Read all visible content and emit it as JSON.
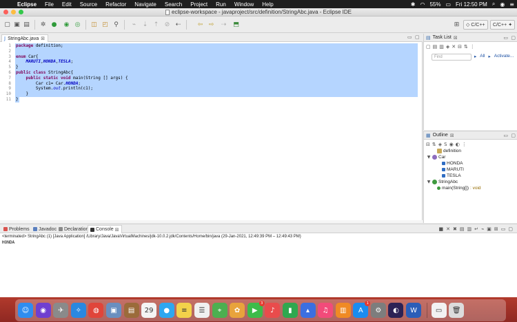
{
  "menubar": {
    "apple": "",
    "items": [
      "Eclipse",
      "File",
      "Edit",
      "Source",
      "Refactor",
      "Navigate",
      "Search",
      "Project",
      "Run",
      "Window",
      "Help"
    ],
    "battery": "55%",
    "clock": "Fri 12:50 PM"
  },
  "window": {
    "title": "eclipse-workspace - javaproject/src/definition/StringAbc.java - Eclipse IDE"
  },
  "toolbar": {
    "perspective_cpp": "C/C++",
    "perspective_cvs": "C/C++"
  },
  "editor": {
    "tab_label": "StringAbc.java",
    "close_glyph": "⊠",
    "lines": [
      {
        "n": "1",
        "html": "<span class=\"kw\">package</span> definition;"
      },
      {
        "n": "2",
        "html": ""
      },
      {
        "n": "3",
        "html": "<span class=\"kw\">enum</span> Car{"
      },
      {
        "n": "4",
        "html": "    <span class=\"en\">MARUTI</span>,<span class=\"en\">HONDA</span>,<span class=\"en\">TESLA</span>;"
      },
      {
        "n": "5",
        "html": "}"
      },
      {
        "n": "6",
        "html": "<span class=\"kw\">public class</span> StringAbc{"
      },
      {
        "n": "7",
        "html": "    <span class=\"kw\">public static void</span> main(String [] args) {"
      },
      {
        "n": "8",
        "html": "        Car c1= Car.<span class=\"en\">HONDA</span>;"
      },
      {
        "n": "9",
        "html": "        System.<span class=\"fld\">out</span>.println(c1);"
      },
      {
        "n": "10",
        "html": "    }"
      },
      {
        "n": "11",
        "html": "}"
      }
    ]
  },
  "tasklist": {
    "tab_label": "Task List",
    "find_placeholder": "Find",
    "all_label": "All",
    "activate_label": "Activate..."
  },
  "outline": {
    "tab_label": "Outline",
    "nodes": [
      {
        "label": "definition",
        "icon": "package-icon",
        "indent": 1,
        "twisty": ""
      },
      {
        "label": "Car",
        "icon": "enum-icon",
        "indent": 0,
        "twisty": "▼"
      },
      {
        "label": "HONDA",
        "icon": "constant-icon",
        "indent": 2,
        "twisty": ""
      },
      {
        "label": "MARUTI",
        "icon": "constant-icon",
        "indent": 2,
        "twisty": ""
      },
      {
        "label": "TESLA",
        "icon": "constant-icon",
        "indent": 2,
        "twisty": ""
      },
      {
        "label": "StringAbc",
        "icon": "class-icon",
        "indent": 0,
        "twisty": "▼"
      },
      {
        "label": "main(String[])",
        "sig": " : void",
        "icon": "method-icon",
        "indent": 1,
        "twisty": ""
      }
    ]
  },
  "console": {
    "tabs": [
      "Problems",
      "Javadoc",
      "Declaration",
      "Console"
    ],
    "active_tab": "Console",
    "status": "<terminated> StringAbc (1) [Java Application] /Library/Java/JavaVirtualMachines/jdk-10.0.2.jdk/Contents/Home/bin/java  (29-Jan-2021, 12:49:39 PM – 12:49:43 PM)",
    "output": "HONDA"
  },
  "dock": {
    "apps": [
      {
        "name": "finder-icon",
        "bg": "#2f8df0",
        "glyph": "☺"
      },
      {
        "name": "siri-icon",
        "bg": "#6f3fd0",
        "glyph": "◉"
      },
      {
        "name": "launchpad-icon",
        "bg": "#8a8a8a",
        "glyph": "✈"
      },
      {
        "name": "safari-icon",
        "bg": "#2a88e0",
        "glyph": "✧"
      },
      {
        "name": "chrome-icon",
        "bg": "#e0453a",
        "glyph": "◍"
      },
      {
        "name": "preview-icon",
        "bg": "#6a8fbf",
        "glyph": "▣"
      },
      {
        "name": "notefile-icon",
        "bg": "#9b6b3a",
        "glyph": "▤"
      },
      {
        "name": "calendar-icon",
        "bg": "#f4f4f4",
        "glyph": "29"
      },
      {
        "name": "messages-icon",
        "bg": "#2ea7f0",
        "glyph": "●"
      },
      {
        "name": "notes-icon",
        "bg": "#f3d24a",
        "glyph": "≡"
      },
      {
        "name": "reminders-icon",
        "bg": "#f0f0f0",
        "glyph": "☰"
      },
      {
        "name": "maps-icon",
        "bg": "#4caf50",
        "glyph": "⌖"
      },
      {
        "name": "photos-icon",
        "bg": "#e8a33c",
        "glyph": "✿"
      },
      {
        "name": "facetime-icon",
        "bg": "#3dbb4a",
        "glyph": "▶",
        "badge": "3"
      },
      {
        "name": "music-icon",
        "bg": "#e94c4c",
        "glyph": "♪"
      },
      {
        "name": "numbers-icon",
        "bg": "#2fa84f",
        "glyph": "▮"
      },
      {
        "name": "keynote-icon",
        "bg": "#3b6fe0",
        "glyph": "▴"
      },
      {
        "name": "itunes-icon",
        "bg": "#f24b7a",
        "glyph": "♫"
      },
      {
        "name": "books-icon",
        "bg": "#f08a24",
        "glyph": "▥"
      },
      {
        "name": "appstore-icon",
        "bg": "#1a8cf0",
        "glyph": "A",
        "badge": "1"
      },
      {
        "name": "system-preferences-icon",
        "bg": "#7d7d7d",
        "glyph": "⚙"
      },
      {
        "name": "eclipse-icon",
        "bg": "#2c2255",
        "glyph": "◐"
      },
      {
        "name": "word-icon",
        "bg": "#2b5eb8",
        "glyph": "W"
      }
    ],
    "trailing": [
      {
        "name": "downloads-stack-icon",
        "bg": "#f2f2f2",
        "glyph": "▭"
      },
      {
        "name": "trash-icon",
        "bg": "#dcdcdc",
        "glyph": "🗑"
      }
    ]
  }
}
